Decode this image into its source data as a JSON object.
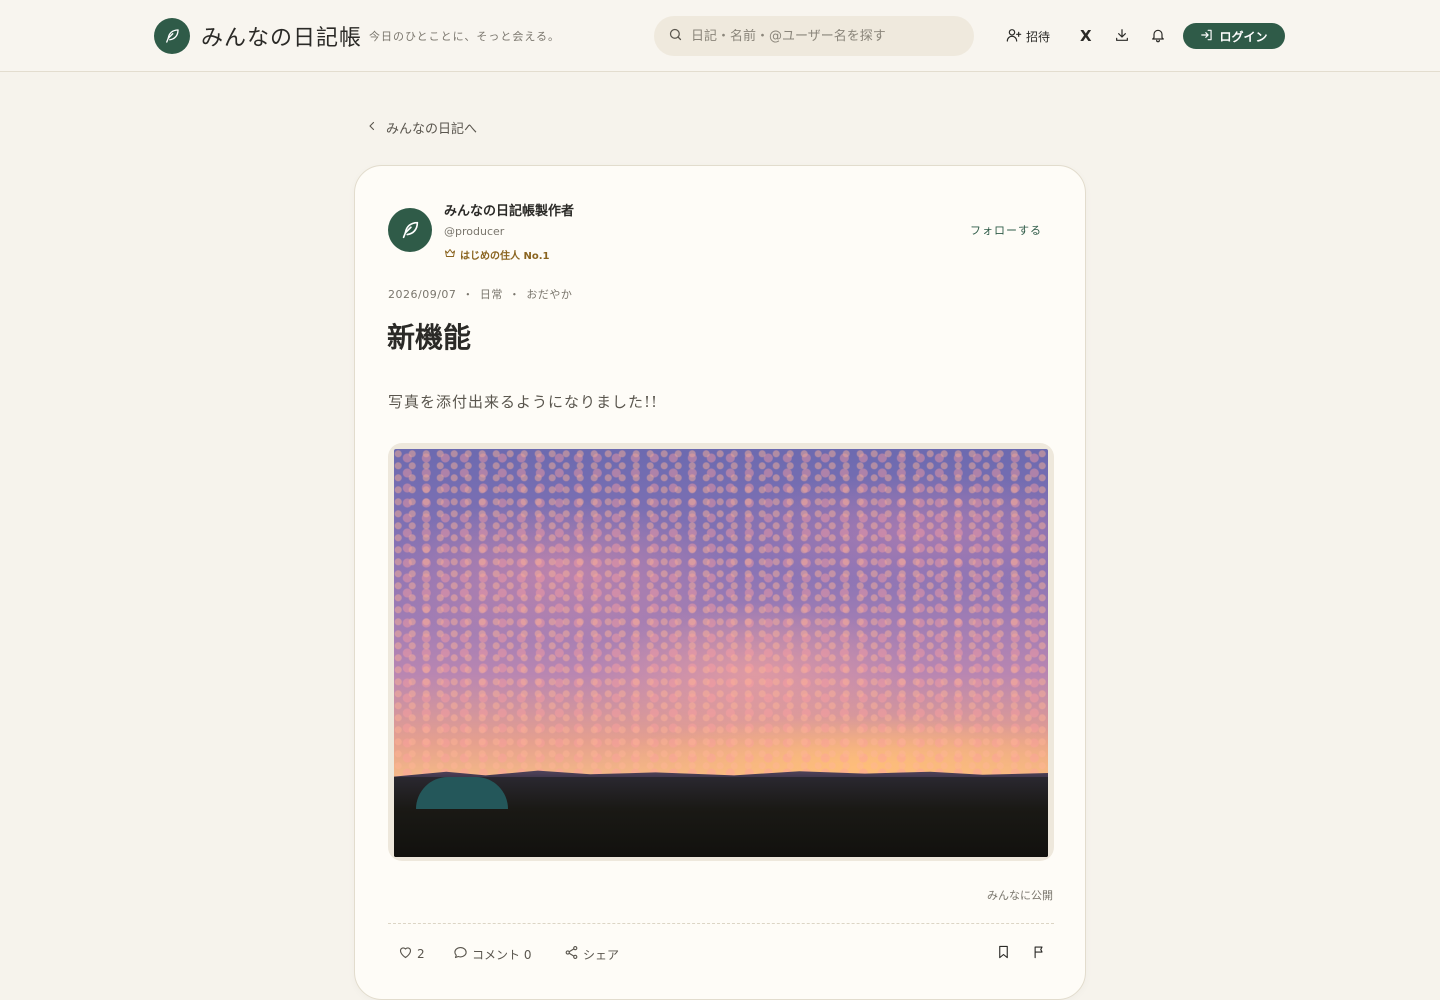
{
  "header": {
    "brand": "みんなの日記帳",
    "tagline": "今日のひとことに、そっと会える。",
    "search_placeholder": "日記・名前・@ユーザー名を探す",
    "invite_label": "招待",
    "x_label": "X",
    "login_label": "ログイン"
  },
  "nav": {
    "back_label": "みんなの日記へ"
  },
  "post": {
    "author_name": "みんなの日記帳製作者",
    "author_handle": "@producer",
    "badge": "はじめの住人 No.1",
    "follow_label": "フォローする",
    "date": "2026/09/07",
    "category": "日常",
    "mood": "おだやか",
    "separator": "・",
    "title": "新機能",
    "body": "写真を添付出来るようになりました!!",
    "visibility": "みんなに公開",
    "likes": "2",
    "comment_label": "コメント 0",
    "share_label": "シェア"
  },
  "colors": {
    "background": "#f6f3ec",
    "accent": "#2f5b48",
    "badge": "#8a6420"
  },
  "icons": {
    "logo": "leaf-pen-icon",
    "search": "search-icon",
    "invite": "user-plus-icon",
    "download": "download-icon",
    "bell": "bell-icon",
    "login": "login-icon",
    "back": "chevron-left-icon",
    "crown": "crown-icon",
    "heart": "heart-icon",
    "comment": "comment-icon",
    "share": "share-icon",
    "bookmark": "bookmark-icon",
    "flag": "flag-icon"
  }
}
